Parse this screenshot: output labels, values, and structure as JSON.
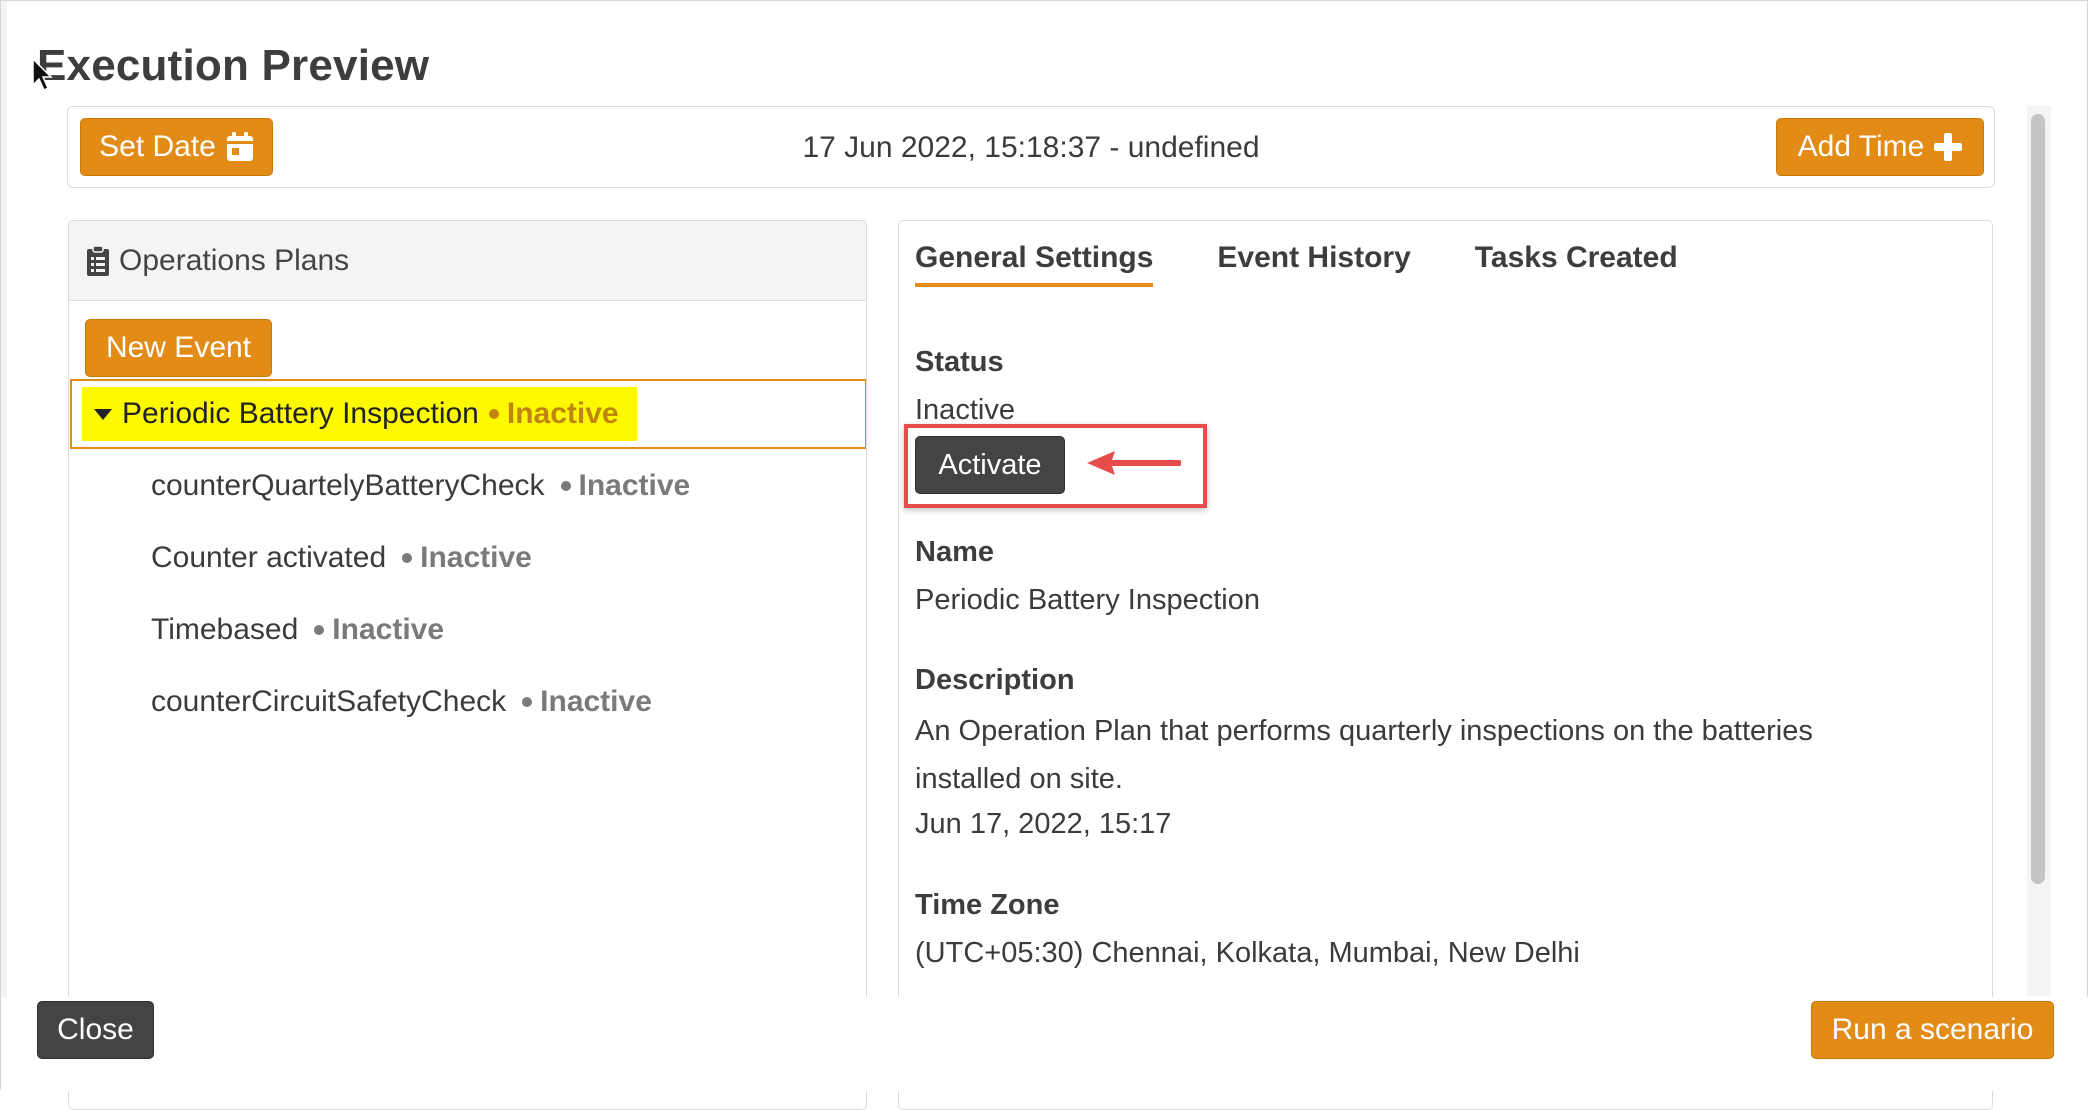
{
  "window": {
    "title": "Execution Preview"
  },
  "toolbar": {
    "set_date_label": "Set Date",
    "add_time_label": "Add Time",
    "datetime_text": "17 Jun 2022, 15:18:37 - undefined"
  },
  "left_panel": {
    "header": "Operations Plans",
    "new_event_label": "New Event",
    "selected_plan": {
      "name": "Periodic Battery Inspection",
      "status": "Inactive"
    },
    "items": [
      {
        "name": "counterQuartelyBatteryCheck",
        "status": "Inactive"
      },
      {
        "name": "Counter activated",
        "status": "Inactive"
      },
      {
        "name": "Timebased",
        "status": "Inactive"
      },
      {
        "name": "counterCircuitSafetyCheck",
        "status": "Inactive"
      }
    ]
  },
  "right_panel": {
    "tabs": [
      {
        "label": "General Settings",
        "active": true
      },
      {
        "label": "Event History",
        "active": false
      },
      {
        "label": "Tasks Created",
        "active": false
      }
    ],
    "status_label": "Status",
    "status_value": "Inactive",
    "activate_label": "Activate",
    "name_label": "Name",
    "name_value": "Periodic Battery Inspection",
    "description_label": "Description",
    "description_value": "An Operation Plan that performs quarterly inspections on the batteries installed on site.",
    "description_date": "Jun 17, 2022, 15:17",
    "timezone_label": "Time Zone",
    "timezone_value": "(UTC+05:30) Chennai, Kolkata, Mumbai, New Delhi"
  },
  "footer": {
    "close_label": "Close",
    "run_label": "Run a scenario"
  },
  "colors": {
    "accent_orange": "#e28b17",
    "dark_button": "#444444",
    "highlight_yellow": "#fdfa00",
    "callout_red": "#e74c4c",
    "inactive_gray": "#7a7a7a"
  },
  "icons": [
    "calendar-icon",
    "plus-icon",
    "clipboard-icon",
    "caret-down-icon",
    "arrow-left-icon",
    "cursor-icon"
  ]
}
